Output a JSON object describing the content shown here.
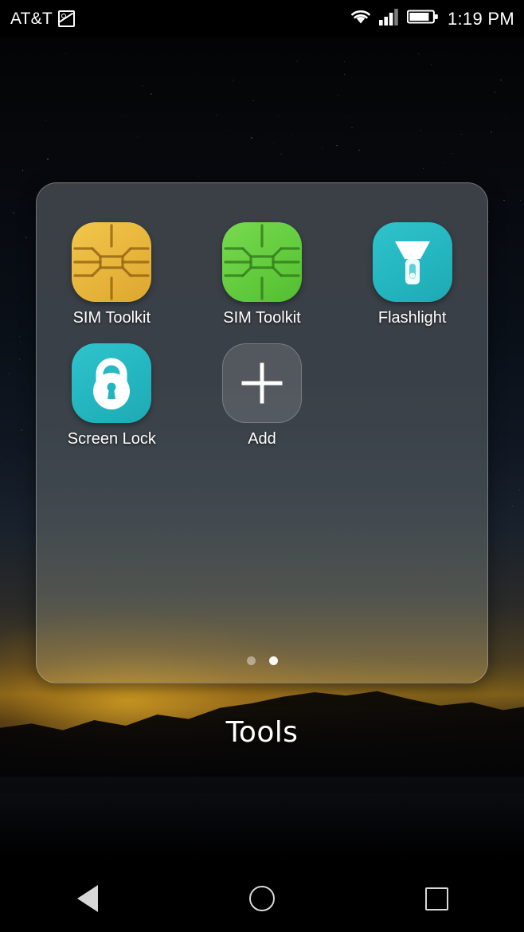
{
  "status_bar": {
    "carrier": "AT&T",
    "time": "1:19 PM",
    "icons": {
      "screenshot": "screenshot-icon",
      "wifi": "wifi-icon",
      "signal": "cellular-signal-icon",
      "battery": "battery-icon"
    },
    "signal_bars_filled": 3,
    "signal_bars_total": 4,
    "wifi_level": 3,
    "battery_level_percent": 78
  },
  "folder": {
    "title": "Tools",
    "apps": [
      {
        "label": "SIM Toolkit",
        "icon": "sim-chip-icon",
        "color": "#e8b53c"
      },
      {
        "label": "SIM Toolkit",
        "icon": "sim-chip-icon",
        "color": "#63cc3e"
      },
      {
        "label": "Flashlight",
        "icon": "flashlight-icon",
        "color": "#23b5bf"
      },
      {
        "label": "Screen Lock",
        "icon": "padlock-icon",
        "color": "#23b5bf"
      },
      {
        "label": "Add",
        "icon": "plus-icon",
        "color": "#6b7279"
      }
    ],
    "pages": 2,
    "current_page": 2
  },
  "nav_bar": {
    "back": "back-button",
    "home": "home-button",
    "recents": "recents-button"
  },
  "theme": {
    "accent_teal": "#23b5bf",
    "accent_gold": "#e8b53c",
    "accent_green": "#63cc3e",
    "panel_bg": "#42484e",
    "text": "#ffffff"
  }
}
